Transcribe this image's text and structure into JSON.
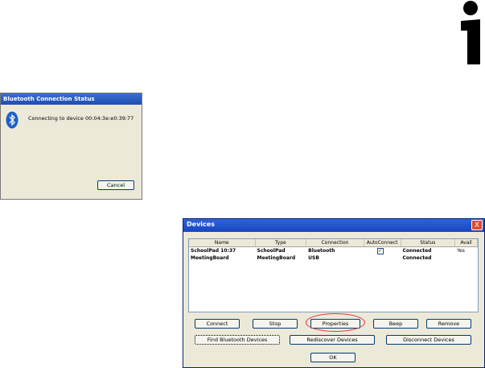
{
  "info_icon": {
    "icon": "info-icon",
    "color": "#000000"
  },
  "bluetooth_status": {
    "title": "Bluetooth Connection Status",
    "icon": "bluetooth-icon",
    "message": "Connecting to device 00:04:3e:e0:39:77",
    "cancel_label": "Cancel"
  },
  "devices": {
    "title": "Devices",
    "close_label": "X",
    "columns": [
      "Name",
      "Type",
      "Connection",
      "AutoConnect",
      "Status",
      "Avail"
    ],
    "rows": [
      {
        "name": "SchoolPad 10:37",
        "type": "SchoolPad",
        "connection": "Bluetooth",
        "autoconnect": "✓",
        "status": "Connected",
        "avail": "Yes"
      },
      {
        "name": "MeetingBoard",
        "type": "MeetingBoard",
        "connection": "USB",
        "autoconnect": "",
        "status": "Connected",
        "avail": ""
      }
    ],
    "buttons": {
      "connect": "Connect",
      "stop": "Stop",
      "properties": "Properties",
      "beep": "Beep",
      "remove": "Remove",
      "find": "Find Bluetooth Devices",
      "rediscover": "Rediscover Devices",
      "disconnect": "Disconnect Devices",
      "ok": "OK"
    },
    "highlight_color": "#d9333a"
  }
}
